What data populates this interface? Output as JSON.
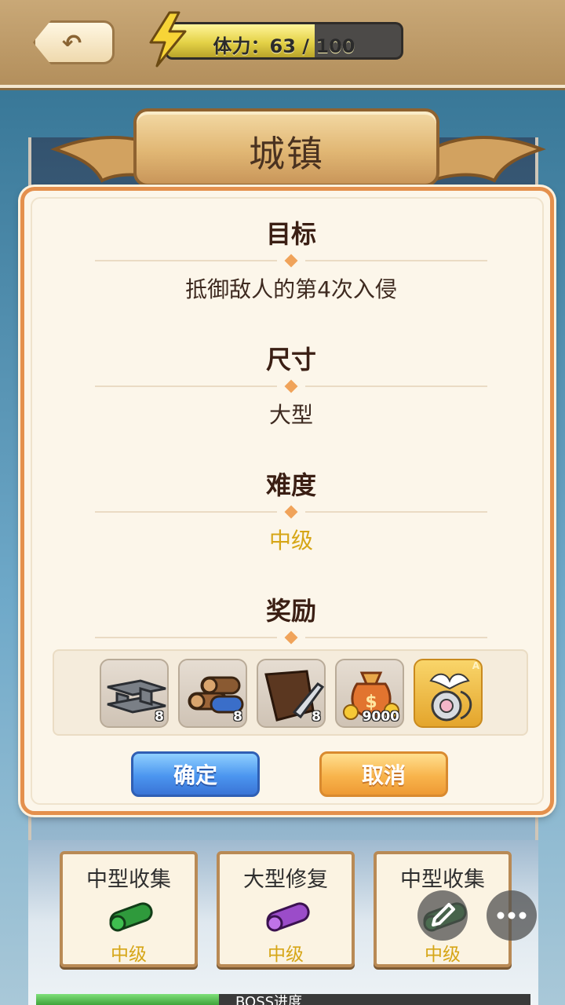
{
  "header": {
    "back_icon": "back-arrow-icon",
    "stamina_icon": "lightning-icon",
    "stamina_label": "体力：63 / 100",
    "stamina_current": 63,
    "stamina_max": 100
  },
  "title": "城镇",
  "modal": {
    "sections": [
      {
        "heading": "目标",
        "value": "抵御敌人的第4次入侵"
      },
      {
        "heading": "尺寸",
        "value": "大型"
      },
      {
        "heading": "难度",
        "value": "中级"
      },
      {
        "heading": "奖励"
      }
    ],
    "rewards": [
      {
        "icon": "steel-beam-icon",
        "count": "8"
      },
      {
        "icon": "wood-log-icon",
        "count": "8"
      },
      {
        "icon": "leather-knife-icon",
        "count": "8"
      },
      {
        "icon": "gold-money-bag-icon",
        "count": "9000"
      },
      {
        "icon": "winged-medal-icon",
        "badge": "A"
      }
    ],
    "confirm_label": "确定",
    "cancel_label": "取消"
  },
  "tasks": [
    {
      "title": "中型收集",
      "level": "中级",
      "scroll_color": "#2f9a3c"
    },
    {
      "title": "大型修复",
      "level": "中级",
      "scroll_color": "#9b4cc9"
    },
    {
      "title": "中型收集",
      "level": "中级",
      "scroll_color": "#2f9a3c"
    }
  ],
  "boss_progress": {
    "label": "BOSS进度",
    "fraction": 0.37
  },
  "floating": {
    "edit_icon": "pencil-icon",
    "more_icon": "more-dots-icon"
  },
  "colors": {
    "accent_orange": "#e4904d",
    "level_gold": "#d6a617",
    "confirm_blue": "#4b95ef",
    "cancel_orange": "#f8b44c"
  }
}
